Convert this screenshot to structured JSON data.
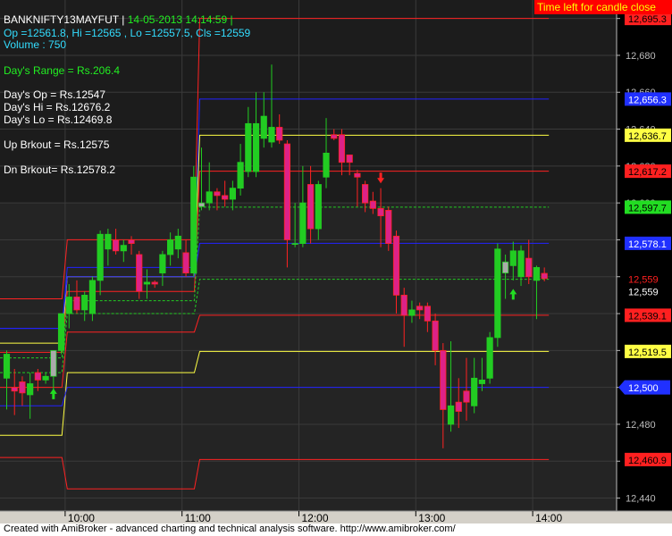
{
  "header": {
    "symbol": "BANKNIFTY13MAYFUT |",
    "datetime": "14-05-2013 14:14:59 |",
    "ohlc": "Op =12561.8, Hi =12565 , Lo =12557.5, Cls =12559",
    "volume": "Volume : 750"
  },
  "info": {
    "days_range": "Day's Range = Rs.206.4",
    "days_op": "Day's Op = Rs.12547",
    "days_hi": "Day's Hi = Rs.12676.2",
    "days_lo": "Day's Lo = Rs.12469.8",
    "up_brkout": "Up Brkout = Rs.12575",
    "dn_brkout": "Dn Brkout= Rs.12578.2"
  },
  "timer_label": "Time left for candle close",
  "footer": "Created with AmiBroker - advanced charting and technical analysis software. http://www.amibroker.com/",
  "colors": {
    "background": "#000000",
    "plot_upper": "#1c1c1c",
    "plot_lower": "#242424",
    "bull": "#22cc22",
    "bear": "#dd2288",
    "doji_gray": "#aaaaaa",
    "red": "#ff2222",
    "blue": "#2222ff",
    "yellow": "#ffff44",
    "green": "#22cc22"
  },
  "chart_data": {
    "type": "candlestick",
    "y_axis": {
      "min": 12433,
      "max": 12710,
      "ticks": [
        {
          "value": 12700,
          "label": "12,700"
        },
        {
          "value": 12680,
          "label": "12,680"
        },
        {
          "value": 12660,
          "label": "12,660"
        },
        {
          "value": 12640,
          "label": "12,640"
        },
        {
          "value": 12620,
          "label": "12,620"
        },
        {
          "value": 12600,
          "label": "12,600"
        },
        {
          "value": 12580,
          "label": "12,580"
        },
        {
          "value": 12560,
          "label": "12,560"
        },
        {
          "value": 12540,
          "label": "12,540"
        },
        {
          "value": 12520,
          "label": "12,520"
        },
        {
          "value": 12500,
          "label": "12,500"
        },
        {
          "value": 12480,
          "label": "12,480"
        },
        {
          "value": 12460,
          "label": "12,460"
        },
        {
          "value": 12440,
          "label": "12,440"
        }
      ]
    },
    "x_axis": {
      "labels": [
        {
          "label": "10:00",
          "bar": 8
        },
        {
          "label": "11:00",
          "bar": 23
        },
        {
          "label": "12:00",
          "bar": 38
        },
        {
          "label": "13:00",
          "bar": 53
        },
        {
          "label": "14:00",
          "bar": 68
        }
      ]
    },
    "candles": [
      {
        "o": 12505,
        "h": 12520,
        "l": 12488,
        "c": 12518
      },
      {
        "o": 12500,
        "h": 12510,
        "l": 12485,
        "c": 12498
      },
      {
        "o": 12503,
        "h": 12506,
        "l": 12490,
        "c": 12497
      },
      {
        "o": 12496,
        "h": 12508,
        "l": 12483,
        "c": 12502
      },
      {
        "o": 12508,
        "h": 12510,
        "l": 12498,
        "c": 12504
      },
      {
        "o": 12504,
        "h": 12508,
        "l": 12502,
        "c": 12506
      },
      {
        "o": 12506,
        "h": 12520,
        "l": 12495,
        "c": 12520
      },
      {
        "o": 12520,
        "h": 12540,
        "l": 12518,
        "c": 12540
      },
      {
        "o": 12540,
        "h": 12556,
        "l": 12532,
        "c": 12549
      },
      {
        "o": 12549,
        "h": 12558,
        "l": 12540,
        "c": 12542
      },
      {
        "o": 12542,
        "h": 12552,
        "l": 12536,
        "c": 12550
      },
      {
        "o": 12540,
        "h": 12560,
        "l": 12536,
        "c": 12558
      },
      {
        "o": 12558,
        "h": 12585,
        "l": 12550,
        "c": 12583
      },
      {
        "o": 12575,
        "h": 12586,
        "l": 12566,
        "c": 12583
      },
      {
        "o": 12580,
        "h": 12586,
        "l": 12572,
        "c": 12574
      },
      {
        "o": 12574,
        "h": 12580,
        "l": 12568,
        "c": 12577
      },
      {
        "o": 12580,
        "h": 12582,
        "l": 12572,
        "c": 12578
      },
      {
        "o": 12572,
        "h": 12574,
        "l": 12548,
        "c": 12552
      },
      {
        "o": 12556,
        "h": 12564,
        "l": 12548,
        "c": 12557
      },
      {
        "o": 12557,
        "h": 12558,
        "l": 12554,
        "c": 12556
      },
      {
        "o": 12562,
        "h": 12574,
        "l": 12555,
        "c": 12572
      },
      {
        "o": 12572,
        "h": 12584,
        "l": 12566,
        "c": 12580
      },
      {
        "o": 12575,
        "h": 12586,
        "l": 12570,
        "c": 12582
      },
      {
        "o": 12573,
        "h": 12580,
        "l": 12560,
        "c": 12562
      },
      {
        "o": 12562,
        "h": 12620,
        "l": 12560,
        "c": 12614
      },
      {
        "o": 12598,
        "h": 12630,
        "l": 12596,
        "c": 12600
      },
      {
        "o": 12600,
        "h": 12622,
        "l": 12596,
        "c": 12606
      },
      {
        "o": 12606,
        "h": 12608,
        "l": 12596,
        "c": 12604
      },
      {
        "o": 12604,
        "h": 12612,
        "l": 12598,
        "c": 12602
      },
      {
        "o": 12602,
        "h": 12612,
        "l": 12596,
        "c": 12608
      },
      {
        "o": 12608,
        "h": 12632,
        "l": 12604,
        "c": 12622
      },
      {
        "o": 12617,
        "h": 12652,
        "l": 12614,
        "c": 12643
      },
      {
        "o": 12617,
        "h": 12660,
        "l": 12614,
        "c": 12643
      },
      {
        "o": 12635,
        "h": 12660,
        "l": 12630,
        "c": 12647
      },
      {
        "o": 12633,
        "h": 12675,
        "l": 12630,
        "c": 12641
      },
      {
        "o": 12641,
        "h": 12648,
        "l": 12632,
        "c": 12634
      },
      {
        "o": 12632,
        "h": 12634,
        "l": 12565,
        "c": 12580
      },
      {
        "o": 12578,
        "h": 12600,
        "l": 12576,
        "c": 12578
      },
      {
        "o": 12578,
        "h": 12620,
        "l": 12576,
        "c": 12600
      },
      {
        "o": 12610,
        "h": 12620,
        "l": 12578,
        "c": 12586
      },
      {
        "o": 12586,
        "h": 12612,
        "l": 12580,
        "c": 12610
      },
      {
        "o": 12614,
        "h": 12646,
        "l": 12608,
        "c": 12627
      },
      {
        "o": 12637,
        "h": 12640,
        "l": 12634,
        "c": 12635
      },
      {
        "o": 12637,
        "h": 12640,
        "l": 12615,
        "c": 12622
      },
      {
        "o": 12626,
        "h": 12626,
        "l": 12615,
        "c": 12622
      },
      {
        "o": 12616,
        "h": 12618,
        "l": 12598,
        "c": 12614
      },
      {
        "o": 12610,
        "h": 12612,
        "l": 12595,
        "c": 12600
      },
      {
        "o": 12601,
        "h": 12606,
        "l": 12594,
        "c": 12597
      },
      {
        "o": 12597,
        "h": 12608,
        "l": 12576,
        "c": 12593
      },
      {
        "o": 12596,
        "h": 12598,
        "l": 12574,
        "c": 12578
      },
      {
        "o": 12582,
        "h": 12585,
        "l": 12540,
        "c": 12550
      },
      {
        "o": 12550,
        "h": 12554,
        "l": 12522,
        "c": 12539
      },
      {
        "o": 12539,
        "h": 12547,
        "l": 12535,
        "c": 12542
      },
      {
        "o": 12544,
        "h": 12546,
        "l": 12537,
        "c": 12542
      },
      {
        "o": 12544,
        "h": 12546,
        "l": 12530,
        "c": 12536
      },
      {
        "o": 12536,
        "h": 12540,
        "l": 12512,
        "c": 12520
      },
      {
        "o": 12520,
        "h": 12524,
        "l": 12467,
        "c": 12488
      },
      {
        "o": 12480,
        "h": 12525,
        "l": 12476,
        "c": 12490
      },
      {
        "o": 12492,
        "h": 12505,
        "l": 12478,
        "c": 12487
      },
      {
        "o": 12498,
        "h": 12516,
        "l": 12482,
        "c": 12492
      },
      {
        "o": 12490,
        "h": 12516,
        "l": 12486,
        "c": 12505
      },
      {
        "o": 12502,
        "h": 12516,
        "l": 12498,
        "c": 12504
      },
      {
        "o": 12505,
        "h": 12530,
        "l": 12502,
        "c": 12527
      },
      {
        "o": 12527,
        "h": 12578,
        "l": 12522,
        "c": 12575
      },
      {
        "o": 12562,
        "h": 12572,
        "l": 12548,
        "c": 12568
      },
      {
        "o": 12566,
        "h": 12579,
        "l": 12558,
        "c": 12574
      },
      {
        "o": 12560,
        "h": 12577,
        "l": 12555,
        "c": 12574
      },
      {
        "o": 12570,
        "h": 12580,
        "l": 12556,
        "c": 12560
      },
      {
        "o": 12558,
        "h": 12566,
        "l": 12537,
        "c": 12565
      },
      {
        "o": 12561.8,
        "h": 12565,
        "l": 12557.5,
        "c": 12559
      }
    ],
    "gray_candles": [
      6,
      25,
      64
    ],
    "level_lines": [
      {
        "name": "red_top",
        "color": "red",
        "dash": false,
        "steps": [
          {
            "bar": 0,
            "v": 12548
          },
          {
            "bar": 8,
            "v": 12580
          },
          {
            "bar": 25,
            "v": 12700
          }
        ],
        "label": "12,695.3"
      },
      {
        "name": "blue_upper",
        "color": "blue",
        "dash": false,
        "steps": [
          {
            "bar": 0,
            "v": 12532
          },
          {
            "bar": 8,
            "v": 12565
          },
          {
            "bar": 25,
            "v": 12656.3
          }
        ],
        "label": "12,656.3"
      },
      {
        "name": "yellow_upper",
        "color": "yellow",
        "dash": false,
        "steps": [
          {
            "bar": 0,
            "v": 12524
          },
          {
            "bar": 8,
            "v": 12560
          },
          {
            "bar": 25,
            "v": 12636.7
          }
        ],
        "label": "12,636.7"
      },
      {
        "name": "red_mid",
        "color": "red",
        "dash": false,
        "steps": [
          {
            "bar": 0,
            "v": 12519
          },
          {
            "bar": 8,
            "v": 12552
          },
          {
            "bar": 25,
            "v": 12617.2
          }
        ],
        "label": "12,617.2"
      },
      {
        "name": "green_upper",
        "color": "green",
        "dash": true,
        "steps": [
          {
            "bar": 0,
            "v": 12516
          },
          {
            "bar": 8,
            "v": 12547
          },
          {
            "bar": 25,
            "v": 12597.7
          }
        ],
        "label": "12,597.7"
      },
      {
        "name": "blue_mid",
        "color": "blue",
        "dash": false,
        "steps": [
          {
            "bar": 0,
            "v": 12532
          },
          {
            "bar": 8,
            "v": 12560
          },
          {
            "bar": 25,
            "v": 12578.1
          }
        ],
        "label": "12,578.1"
      },
      {
        "name": "green_lower",
        "color": "green",
        "dash": true,
        "steps": [
          {
            "bar": 0,
            "v": 12508
          },
          {
            "bar": 8,
            "v": 12540
          },
          {
            "bar": 25,
            "v": 12558.6
          }
        ],
        "label": "12,558.6"
      },
      {
        "name": "red_lower",
        "color": "red",
        "dash": false,
        "steps": [
          {
            "bar": 0,
            "v": 12500
          },
          {
            "bar": 8,
            "v": 12530
          },
          {
            "bar": 25,
            "v": 12539.1
          }
        ],
        "label": "12,539.1"
      },
      {
        "name": "yellow_lower",
        "color": "yellow",
        "dash": false,
        "steps": [
          {
            "bar": 0,
            "v": 12474
          },
          {
            "bar": 8,
            "v": 12508
          },
          {
            "bar": 25,
            "v": 12519.5
          }
        ],
        "label": "12,519.5"
      },
      {
        "name": "blue_low",
        "color": "blue",
        "dash": false,
        "steps": [
          {
            "bar": 0,
            "v": 12490
          },
          {
            "bar": 8,
            "v": 12500
          },
          {
            "bar": 25,
            "v": 12500
          }
        ],
        "label": "12,500"
      },
      {
        "name": "red_bottom",
        "color": "red",
        "dash": false,
        "steps": [
          {
            "bar": 0,
            "v": 12462
          },
          {
            "bar": 8,
            "v": 12445
          },
          {
            "bar": 25,
            "v": 12460.9
          }
        ],
        "label": "12,460.9"
      }
    ],
    "extra_price_labels": [
      {
        "value": 12559,
        "label": "12,559",
        "style": "red_on_black"
      },
      {
        "value": 12559,
        "label": "12,559",
        "style": "white_on_black",
        "offset": 1
      }
    ],
    "arrows": [
      {
        "bar": 6,
        "dir": "up",
        "price": 12496,
        "color": "green"
      },
      {
        "bar": 48,
        "dir": "down",
        "price": 12614,
        "color": "red"
      },
      {
        "bar": 65,
        "dir": "up",
        "price": 12550,
        "color": "green"
      }
    ]
  }
}
